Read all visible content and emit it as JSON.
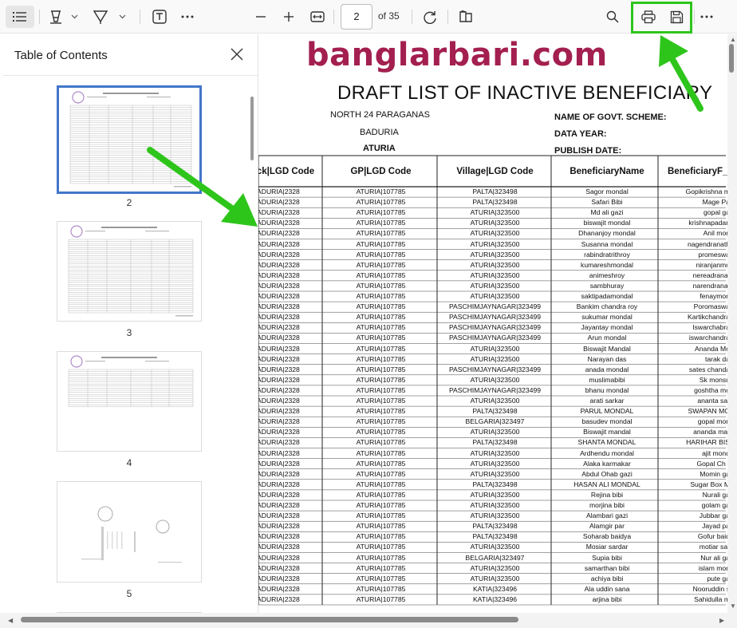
{
  "watermark": "banglarbari.com",
  "toolbar": {
    "page_number": "2",
    "page_of": "of 35"
  },
  "sidebar": {
    "title": "Table of Contents",
    "thumbnails": [
      {
        "label": "2",
        "selected": true
      },
      {
        "label": "3",
        "selected": false
      },
      {
        "label": "4",
        "selected": false
      },
      {
        "label": "5",
        "selected": false
      }
    ]
  },
  "document": {
    "title": "DRAFT LIST OF INACTIVE BENEFICIARY",
    "district": "NORTH 24 PARAGANAS",
    "block": "BADURIA",
    "gp": "ATURIA",
    "scheme_label": "NAME OF GOVT. SCHEME:",
    "year_label": "DATA YEAR:",
    "publish_label": "PUBLISH DATE:",
    "headers": [
      "ck|LGD Code",
      "GP|LGD Code",
      "Village|LGD Code",
      "BeneficiaryName",
      "BeneficiaryF_"
    ],
    "rows": [
      [
        "ADURIA|2328",
        "ATURIA|107785",
        "PALTA|323498",
        "Sagor mondal",
        "Gopikrishna m"
      ],
      [
        "ADURIA|2328",
        "ATURIA|107785",
        "PALTA|323498",
        "Safari Bibi",
        "Mage Pa"
      ],
      [
        "ADURIA|2328",
        "ATURIA|107785",
        "ATURIA|323500",
        "Md ali gazi",
        "gopal ga"
      ],
      [
        "ADURIA|2328",
        "ATURIA|107785",
        "ATURIA|323500",
        "biswajit mondal",
        "krishnapadan"
      ],
      [
        "ADURIA|2328",
        "ATURIA|107785",
        "ATURIA|323500",
        "Dhananjoy mondal",
        "Anil mon"
      ],
      [
        "ADURIA|2328",
        "ATURIA|107785",
        "ATURIA|323500",
        "Susanna mondal",
        "nagendranath"
      ],
      [
        "ADURIA|2328",
        "ATURIA|107785",
        "ATURIA|323500",
        "rabindratrithroy",
        "promeswa"
      ],
      [
        "ADURIA|2328",
        "ATURIA|107785",
        "ATURIA|323500",
        "kumareshmondal",
        "niranjanmo"
      ],
      [
        "ADURIA|2328",
        "ATURIA|107785",
        "ATURIA|323500",
        "animeshroy",
        "nereadranat"
      ],
      [
        "ADURIA|2328",
        "ATURIA|107785",
        "ATURIA|323500",
        "sambhuray",
        "narendranat"
      ],
      [
        "ADURIA|2328",
        "ATURIA|107785",
        "ATURIA|323500",
        "saktipadamondal",
        "fenaymon"
      ],
      [
        "ADURIA|2328",
        "ATURIA|107785",
        "PASCHIMJAYNAGAR|323499",
        "Bankim chandra roy",
        "Poromaswa"
      ],
      [
        "ADURIA|2328",
        "ATURIA|107785",
        "PASCHIMJAYNAGAR|323499",
        "sukumar mondal",
        "Kartikchandra"
      ],
      [
        "ADURIA|2328",
        "ATURIA|107785",
        "PASCHIMJAYNAGAR|323499",
        "Jayantay mondal",
        "Iswarchabra"
      ],
      [
        "ADURIA|2328",
        "ATURIA|107785",
        "PASCHIMJAYNAGAR|323499",
        "Arun mondal",
        "iswarchandra"
      ],
      [
        "ADURIA|2328",
        "ATURIA|107785",
        "ATURIA|323500",
        "Biswajit Mandal",
        "Ananda Mo"
      ],
      [
        "ADURIA|2328",
        "ATURIA|107785",
        "ATURIA|323500",
        "Narayan das",
        "tarak da"
      ],
      [
        "ADURIA|2328",
        "ATURIA|107785",
        "PASCHIMJAYNAGAR|323499",
        "anada mondal",
        "sates chanda"
      ],
      [
        "ADURIA|2328",
        "ATURIA|107785",
        "ATURIA|323500",
        "muslimabibi",
        "Sk monsu"
      ],
      [
        "ADURIA|2328",
        "ATURIA|107785",
        "PASCHIMJAYNAGAR|323499",
        "bhanu mondal",
        "goshtha mo"
      ],
      [
        "ADURIA|2328",
        "ATURIA|107785",
        "ATURIA|323500",
        "arati sarkar",
        "ananta sar"
      ],
      [
        "ADURIA|2328",
        "ATURIA|107785",
        "PALTA|323498",
        "PARUL MONDAL",
        "SWAPAN MO"
      ],
      [
        "ADURIA|2328",
        "ATURIA|107785",
        "BELGARIA|323497",
        "basudev mondal",
        "gopal mon"
      ],
      [
        "ADURIA|2328",
        "ATURIA|107785",
        "ATURIA|323500",
        "Biswajit mandal",
        "ananda mar"
      ],
      [
        "ADURIA|2328",
        "ATURIA|107785",
        "PALTA|323498",
        "SHANTA MONDAL",
        "HARIHAR BIS"
      ],
      [
        "ADURIA|2328",
        "ATURIA|107785",
        "ATURIA|323500",
        "Ardhendu mondal",
        "ajit mond"
      ],
      [
        "ADURIA|2328",
        "ATURIA|107785",
        "ATURIA|323500",
        "Alaka karmakar",
        "Gopal Ch r"
      ],
      [
        "ADURIA|2328",
        "ATURIA|107785",
        "ATURIA|323500",
        "Abdul Ohab gazi",
        "Momin ga"
      ],
      [
        "ADURIA|2328",
        "ATURIA|107785",
        "PALTA|323498",
        "HASAN ALI MONDAL",
        "Sugar Box M"
      ],
      [
        "ADURIA|2328",
        "ATURIA|107785",
        "ATURIA|323500",
        "Rejina bibi",
        "Nurali ga"
      ],
      [
        "ADURIA|2328",
        "ATURIA|107785",
        "ATURIA|323500",
        "morjina bibi",
        "golam ga"
      ],
      [
        "ADURIA|2328",
        "ATURIA|107785",
        "ATURIA|323500",
        "Alambari gazi",
        "Jubbar ga"
      ],
      [
        "ADURIA|2328",
        "ATURIA|107785",
        "PALTA|323498",
        "Alamgir par",
        "Jayad pa"
      ],
      [
        "ADURIA|2328",
        "ATURIA|107785",
        "PALTA|323498",
        "Soharab baidya",
        "Gofur baid"
      ],
      [
        "ADURIA|2328",
        "ATURIA|107785",
        "ATURIA|323500",
        "Mosiar sardar",
        "motiar sar"
      ],
      [
        "ADURIA|2328",
        "ATURIA|107785",
        "BELGARIA|323497",
        "Supia bibi",
        "Nur ali ga"
      ],
      [
        "ADURIA|2328",
        "ATURIA|107785",
        "ATURIA|323500",
        "samarthan bibi",
        "islam mon"
      ],
      [
        "ADURIA|2328",
        "ATURIA|107785",
        "ATURIA|323500",
        "achiya bibi",
        "pute ga"
      ],
      [
        "ADURIA|2328",
        "ATURIA|107785",
        "KATIA|323496",
        "Ala uddin sana",
        "Nooruddin s"
      ],
      [
        "ADURIA|2328",
        "ATURIA|107785",
        "KATIA|323496",
        "arjina bibi",
        "Sahidulla m"
      ]
    ]
  },
  "colors": {
    "accent_select": "#4276c9",
    "highlight_green": "#2ec51b",
    "watermark": "#a31f4f"
  },
  "icons": [
    "toc-list-icon",
    "highlight-icon",
    "draw-icon",
    "chevron-down-icon",
    "text-box-icon",
    "more-icon",
    "zoom-out-icon",
    "zoom-in-icon",
    "fit-width-icon",
    "rotate-icon",
    "page-view-icon",
    "search-icon",
    "print-icon",
    "save-icon",
    "close-icon"
  ]
}
